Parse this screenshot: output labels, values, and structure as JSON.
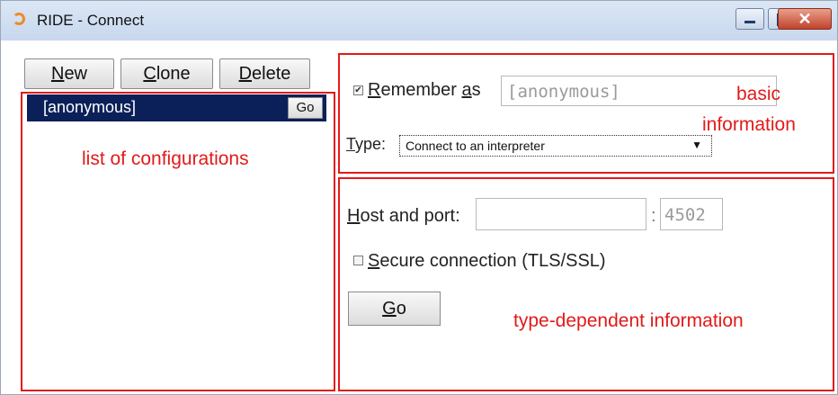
{
  "window": {
    "title": "RIDE - Connect",
    "close_glyph": "✕"
  },
  "toolbar": {
    "new_rest": "ew",
    "new_key": "N",
    "clone_key": "C",
    "clone_rest": "lone",
    "delete_key": "D",
    "delete_rest": "elete"
  },
  "configs": {
    "items": [
      {
        "label": "[anonymous]",
        "go_label": "Go"
      }
    ]
  },
  "annotations": {
    "list": "list of configurations",
    "basic_1": "basic",
    "basic_2": "information",
    "type_dependent": "type-dependent information"
  },
  "basic": {
    "remember_key": "R",
    "remember_rest": "emember ",
    "as_key": "a",
    "as_rest": "s",
    "remember_checked": true,
    "name_value": "[anonymous]",
    "type_key": "T",
    "type_rest": "ype:",
    "type_value": "Connect to an interpreter",
    "type_arrow": "▼"
  },
  "connection": {
    "host_key": "H",
    "host_rest": "ost and port:",
    "host_value": "",
    "colon": ":",
    "port_value": "4502",
    "secure_key": "S",
    "secure_rest": "ecure connection (TLS/SSL)",
    "secure_checked": false,
    "go_key": "G",
    "go_rest": "o"
  },
  "colors": {
    "annotation": "#e21a1a",
    "selection": "#0b2058",
    "titlebar": "#c7d7ee"
  }
}
